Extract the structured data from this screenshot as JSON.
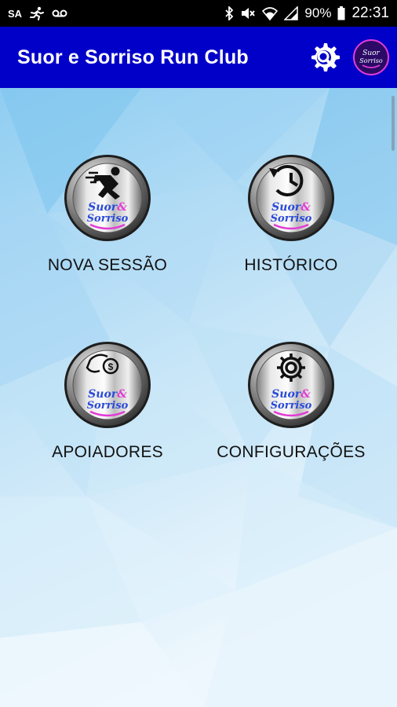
{
  "status_bar": {
    "carrier": "SA",
    "battery_percent": "90%",
    "time": "22:31",
    "icons": [
      "running-person-icon",
      "voicemail-icon",
      "bluetooth-icon",
      "mute-icon",
      "wifi-icon",
      "signal-icon",
      "battery-icon"
    ]
  },
  "app_bar": {
    "title": "Suor e Sorriso Run Club",
    "settings_icon": "settings-search-icon",
    "logo_text_line1": "Suor",
    "logo_text_line2": "Sorriso"
  },
  "menu": {
    "tiles": [
      {
        "label": "NOVA SESSÃO",
        "icon": "sprinter-icon"
      },
      {
        "label": "HISTÓRICO",
        "icon": "history-clock-icon"
      },
      {
        "label": "APOIADORES",
        "icon": "hand-coin-icon"
      },
      {
        "label": "CONFIGURAÇÕES",
        "icon": "gear-icon"
      }
    ],
    "badge_text_line1": "Suor",
    "badge_text_line2": "Sorriso"
  },
  "colors": {
    "app_bar": "#0000c8",
    "status_bar": "#000000",
    "badge_pink": "#e23bd4",
    "badge_blue": "#2a4bd8"
  }
}
